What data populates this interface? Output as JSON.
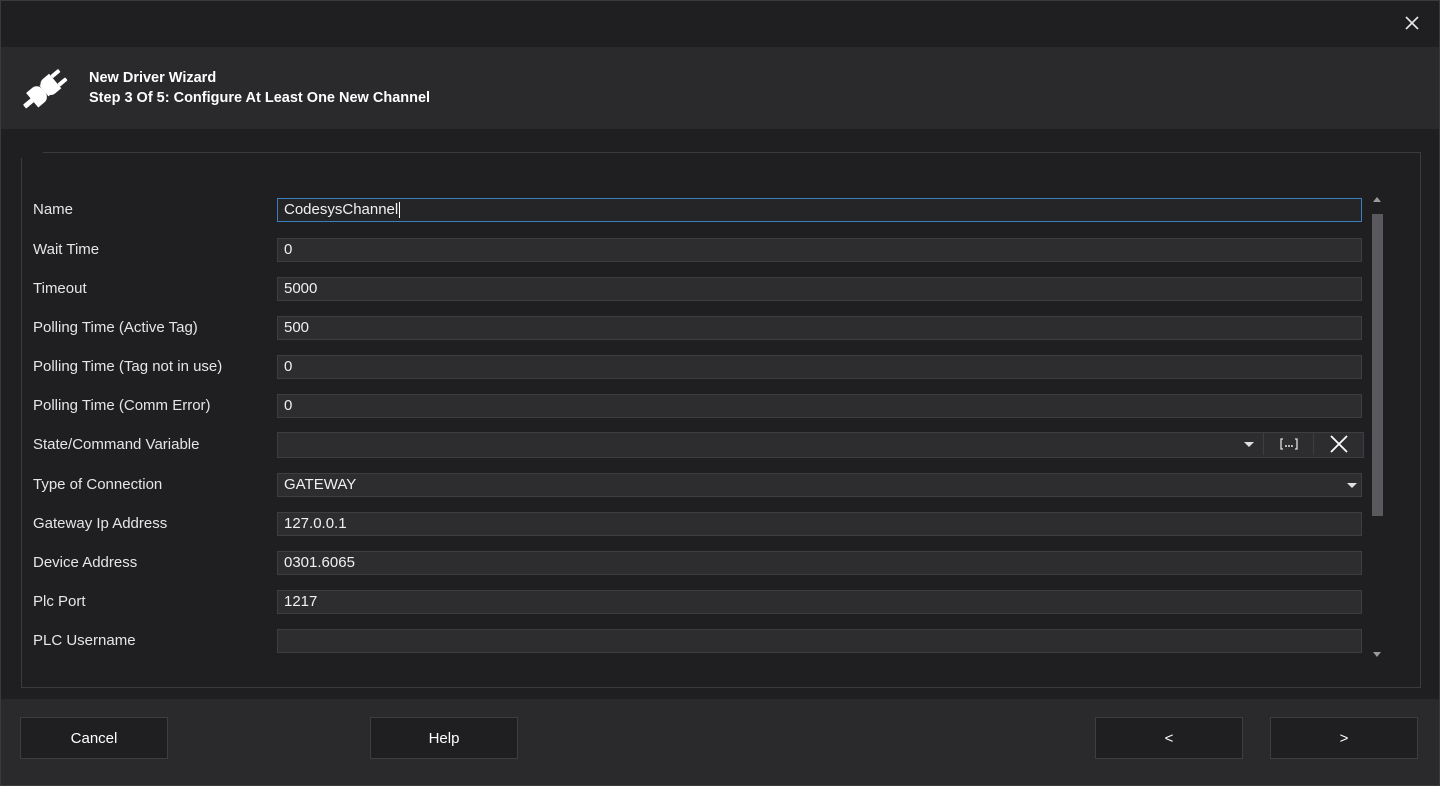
{
  "window": {
    "close_icon": "close-icon"
  },
  "header": {
    "icon": "plug-icon",
    "title": "New Driver Wizard",
    "subtitle": "Step 3 Of 5: Configure At Least One New Channel"
  },
  "form": {
    "fields": [
      {
        "label": "Name",
        "value": "CodesysChannel"
      },
      {
        "label": "Wait Time",
        "value": "0"
      },
      {
        "label": "Timeout",
        "value": "5000"
      },
      {
        "label": "Polling Time (Active Tag)",
        "value": "500"
      },
      {
        "label": "Polling Time (Tag not in use)",
        "value": "0"
      },
      {
        "label": "Polling Time (Comm Error)",
        "value": "0"
      },
      {
        "label": "State/Command Variable",
        "value": ""
      },
      {
        "label": "Type of Connection",
        "value": "GATEWAY"
      },
      {
        "label": "Gateway Ip Address",
        "value": "127.0.0.1"
      },
      {
        "label": "Device Address",
        "value": "0301.6065"
      },
      {
        "label": "Plc Port",
        "value": "1217"
      },
      {
        "label": "PLC Username",
        "value": ""
      }
    ]
  },
  "footer": {
    "cancel_label": "Cancel",
    "help_label": "Help",
    "back_label": "<",
    "next_label": ">"
  }
}
